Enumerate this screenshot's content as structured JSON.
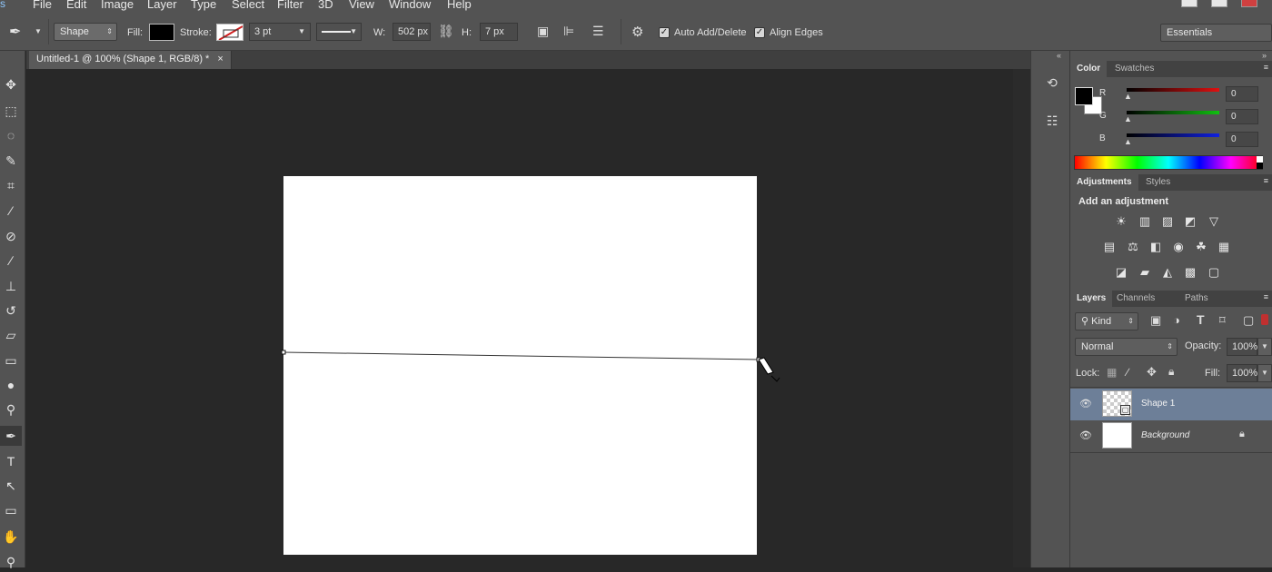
{
  "menu": {
    "items": [
      "File",
      "Edit",
      "Image",
      "Layer",
      "Type",
      "Select",
      "Filter",
      "3D",
      "View",
      "Window",
      "Help"
    ]
  },
  "options": {
    "mode": "Shape",
    "fill_label": "Fill:",
    "stroke_label": "Stroke:",
    "stroke_width": "3 pt",
    "w_label": "W:",
    "w_value": "502 px",
    "h_label": "H:",
    "h_value": "7 px",
    "auto_add_delete": "Auto Add/Delete",
    "align_edges": "Align Edges",
    "workspace": "Essentials"
  },
  "document": {
    "tab_title": "Untitled-1 @ 100% (Shape 1, RGB/8) *",
    "close": "×"
  },
  "color_panel": {
    "tabs": [
      "Color",
      "Swatches"
    ],
    "channels": [
      {
        "label": "R",
        "value": "0",
        "color": "#e01010"
      },
      {
        "label": "G",
        "value": "0",
        "color": "#10c010"
      },
      {
        "label": "B",
        "value": "0",
        "color": "#1020e0"
      }
    ]
  },
  "adjustments_panel": {
    "tabs": [
      "Adjustments",
      "Styles"
    ],
    "heading": "Add an adjustment",
    "icons": [
      [
        "brightness-contrast-icon",
        "levels-icon",
        "curves-icon",
        "exposure-icon",
        "vibrance-icon"
      ],
      [
        "hue-saturation-icon",
        "color-balance-icon",
        "black-white-icon",
        "photo-filter-icon",
        "channel-mixer-icon",
        "color-lookup-icon"
      ],
      [
        "invert-icon",
        "posterize-icon",
        "threshold-icon",
        "gradient-map-icon",
        "selective-color-icon"
      ]
    ]
  },
  "layers_panel": {
    "tabs": [
      "Layers",
      "Channels",
      "Paths"
    ],
    "filter_kind": "Kind",
    "blend_mode": "Normal",
    "opacity_label": "Opacity:",
    "opacity_value": "100%",
    "lock_label": "Lock:",
    "fill_label": "Fill:",
    "fill_value": "100%",
    "layers": [
      {
        "name": "Shape 1",
        "selected": true
      },
      {
        "name": "Background",
        "selected": false
      }
    ]
  }
}
